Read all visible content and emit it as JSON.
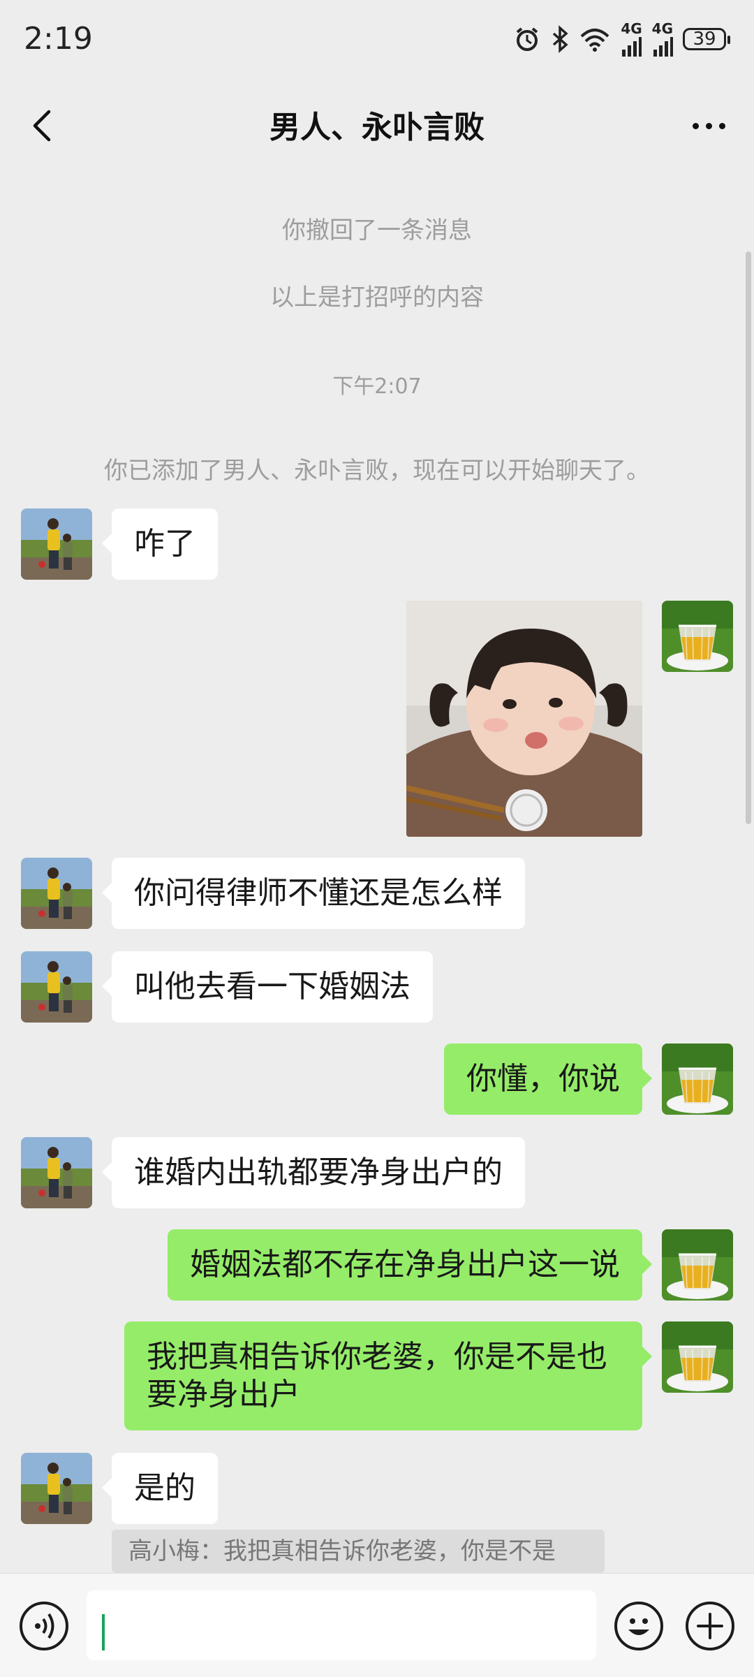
{
  "status_bar": {
    "time": "2:19",
    "network_1": "4G",
    "network_2": "4G",
    "battery": "39"
  },
  "header": {
    "title": "男人、永卟言败"
  },
  "system_messages": {
    "recall_notice": "你撤回了一条消息",
    "greeting_notice": "以上是打招呼的内容",
    "timestamp": "下午2:07",
    "added_notice": "你已添加了男人、永卟言败，现在可以开始聊天了。"
  },
  "messages": [
    {
      "side": "in",
      "text": "咋了"
    },
    {
      "side": "out",
      "type": "image",
      "content": "sticker-baby-eating"
    },
    {
      "side": "in",
      "text": "你问得律师不懂还是怎么样"
    },
    {
      "side": "in",
      "text": "叫他去看一下婚姻法"
    },
    {
      "side": "out",
      "text": "你懂，你说"
    },
    {
      "side": "in",
      "text": "谁婚内出轨都要净身出户的"
    },
    {
      "side": "out",
      "text": "婚姻法都不存在净身出户这一说"
    },
    {
      "side": "out",
      "text_line1": "我把真相告诉你老婆，你是不是也",
      "text_line2": "要净身出户"
    },
    {
      "side": "in",
      "text": "是的"
    }
  ],
  "quoted_reply": {
    "text": "高小梅：我把真相告诉你老婆，你是不是"
  },
  "input_bar": {
    "voice_icon": "voice-icon",
    "emoji_icon": "emoji-icon",
    "plus_icon": "plus-icon"
  },
  "colors": {
    "background": "#ededed",
    "outgoing_bubble": "#95ec69",
    "incoming_bubble": "#ffffff",
    "cursor": "#19a35b"
  }
}
